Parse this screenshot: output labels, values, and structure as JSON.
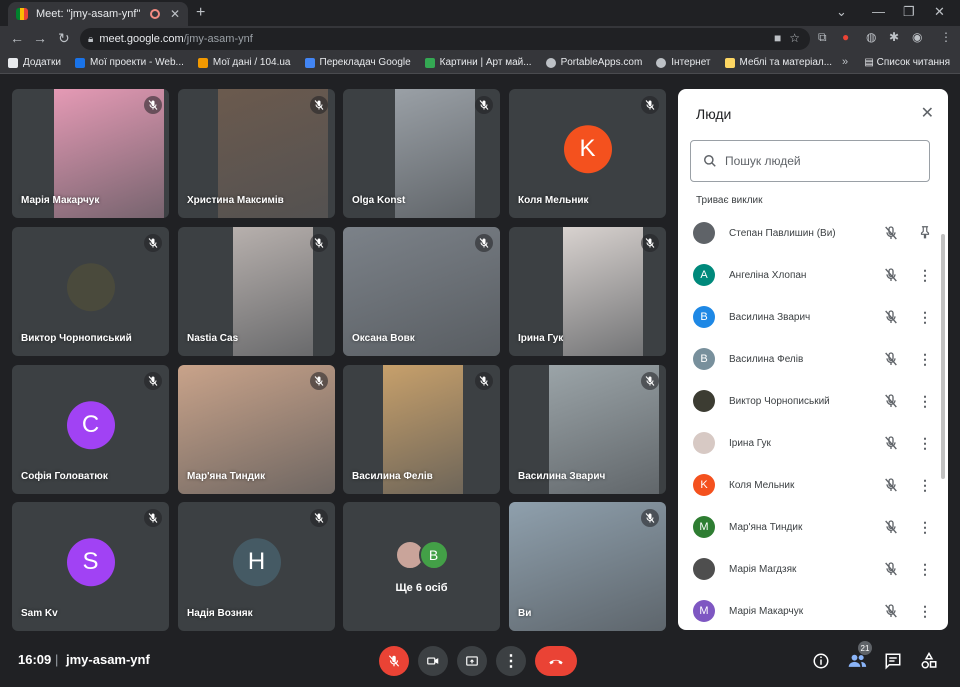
{
  "browser": {
    "tab_title": "Meet: \"jmy-asam-ynf\"",
    "url_host": "meet.google.com",
    "url_path": "/jmy-asam-ynf",
    "bookmarks": [
      {
        "label": "Додатки",
        "color": "#e8eaed"
      },
      {
        "label": "Мої проекти - Web...",
        "color": "#1a73e8"
      },
      {
        "label": "Мої дані / 104.ua",
        "color": "#f29900"
      },
      {
        "label": "Перекладач Google",
        "color": "#4285f4"
      },
      {
        "label": "Картини | Арт май...",
        "color": "#34a853"
      },
      {
        "label": "PortableApps.com",
        "color": "#bdc1c6"
      },
      {
        "label": "Інтернет",
        "color": "#bdc1c6"
      },
      {
        "label": "Меблі та матеріал...",
        "color": "#fdd663"
      }
    ],
    "reading_list": "Список читання"
  },
  "tiles": [
    {
      "name": "Марія Макарчук",
      "type": "video",
      "bg": "#e59ab5",
      "vx": 42,
      "vw": 110
    },
    {
      "name": "Христина Максимів",
      "type": "video",
      "bg": "#6b5a4e",
      "vx": 40,
      "vw": 110
    },
    {
      "name": "Olga Konst",
      "type": "video",
      "bg": "#9aa0a6",
      "vx": 52,
      "vw": 80
    },
    {
      "name": "Коля Мельник",
      "type": "avatar",
      "letter": "K",
      "color": "#f4511e"
    },
    {
      "name": "Виктор Чорнописький",
      "type": "photo-avatar",
      "color": "#4a4a3c"
    },
    {
      "name": "Nastia Cas",
      "type": "video",
      "bg": "#b7b0ad",
      "vx": 55,
      "vw": 80
    },
    {
      "name": "Оксана Вовк",
      "type": "video",
      "bg": "#7c8289",
      "vx": 0,
      "vw": 157
    },
    {
      "name": "Ірина Гук",
      "type": "video",
      "bg": "#d8d2cf",
      "vx": 54,
      "vw": 80
    },
    {
      "name": "Софія Головатюк",
      "type": "avatar",
      "letter": "C",
      "color": "#a142f4"
    },
    {
      "name": "Мар'яна Тиндик",
      "type": "video",
      "bg": "#c9a38a",
      "vx": 0,
      "vw": 157
    },
    {
      "name": "Василина Фелів",
      "type": "video",
      "bg": "#c7a06b",
      "vx": 40,
      "vw": 80
    },
    {
      "name": "Василина Зварич",
      "type": "video",
      "bg": "#9ba4a8",
      "vx": 40,
      "vw": 110
    },
    {
      "name": "Sam Kv",
      "type": "avatar",
      "letter": "S",
      "color": "#a142f4"
    },
    {
      "name": "Надія Возняк",
      "type": "avatar",
      "letter": "H",
      "color": "#455a64"
    },
    {
      "name": "Ще 6 осіб",
      "type": "more",
      "letter": "B",
      "color": "#43a047"
    },
    {
      "name": "Ви",
      "type": "video",
      "bg": "#8fa0ad",
      "vx": 0,
      "vw": 157
    }
  ],
  "panel": {
    "title": "Люди",
    "search_placeholder": "Пошук людей",
    "section": "Триває виклик",
    "people": [
      {
        "name": "Степан Павлишин (Ви)",
        "letter": "",
        "color": "#5f6368",
        "photo": true,
        "pin": true
      },
      {
        "name": "Ангеліна Хлопан",
        "letter": "A",
        "color": "#00897b"
      },
      {
        "name": "Василина Зварич",
        "letter": "B",
        "color": "#1e88e5"
      },
      {
        "name": "Василина Фелів",
        "letter": "B",
        "color": "#78909c"
      },
      {
        "name": "Виктор Чорнописький",
        "letter": "",
        "color": "#3c3c32",
        "photo": true
      },
      {
        "name": "Ірина Гук",
        "letter": "",
        "color": "#d7c9c4",
        "photo": true
      },
      {
        "name": "Коля Мельник",
        "letter": "K",
        "color": "#f4511e"
      },
      {
        "name": "Мар'яна Тиндик",
        "letter": "M",
        "color": "#2e7d32"
      },
      {
        "name": "Марія Магдзяк",
        "letter": "",
        "color": "#4e4e4e",
        "photo": true
      },
      {
        "name": "Марія Макарчук",
        "letter": "M",
        "color": "#7e57c2"
      }
    ]
  },
  "bottom": {
    "time": "16:09",
    "separator": "|",
    "meeting_code": "jmy-asam-ynf",
    "participants_badge": "21"
  }
}
